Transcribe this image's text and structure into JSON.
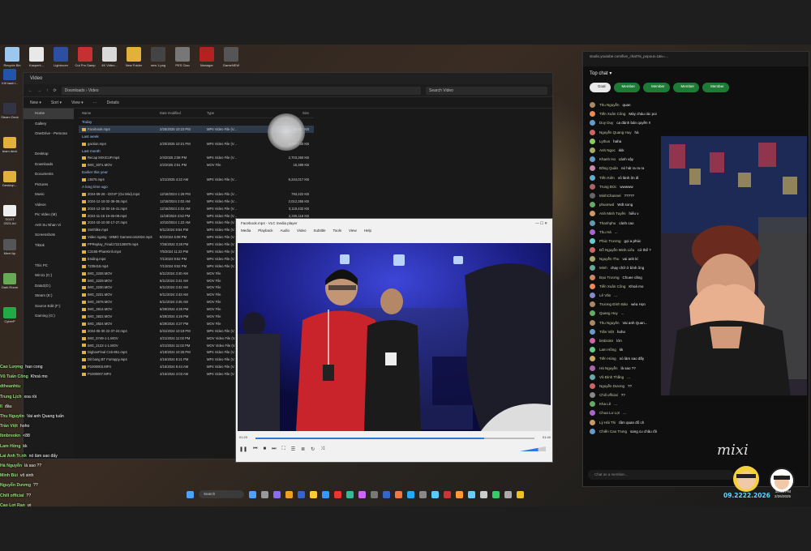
{
  "desktop_icons": [
    {
      "label": "Recycle Bin",
      "color": "#9cc8f0"
    },
    {
      "label": "Kasperk...",
      "color": "#e8e8e8"
    },
    {
      "label": "Lightroom",
      "color": "#2c4fa3"
    },
    {
      "label": "Cut Pro Samp",
      "color": "#c53030"
    },
    {
      "label": "4K Video...",
      "color": "#d9d9d9"
    },
    {
      "label": "New Folder",
      "color": "#e1b13b"
    },
    {
      "label": "new 1.png",
      "color": "#444"
    },
    {
      "label": "PES Ciao",
      "color": "#777"
    },
    {
      "label": "Manager",
      "color": "#b52020"
    },
    {
      "label": "GameNEW",
      "color": "#555"
    }
  ],
  "left_icons": [
    {
      "label": "Kill hash t..",
      "color": "#2255aa"
    },
    {
      "label": "Steam Deck",
      "color": "#334"
    },
    {
      "label": "team deck",
      "color": "#e1b13b"
    },
    {
      "label": "Desktop...",
      "color": "#e1b13b"
    },
    {
      "label": "SGGT 2023-Ad",
      "color": "#eee"
    },
    {
      "label": "Meet Ap",
      "color": "#555"
    },
    {
      "label": "Dark Room",
      "color": "#6a5"
    },
    {
      "label": "CyberP",
      "color": "#2a4"
    }
  ],
  "explorer": {
    "title": "Video",
    "path": "Downloads  ›  Video",
    "search_placeholder": "Search Video",
    "toolbar": [
      "New ▾",
      "Sort ▾",
      "View ▾",
      "···",
      "Details"
    ],
    "nav": [
      "Home",
      "Gallery",
      "OneDrive - Persona",
      "",
      "Desktop",
      "Downloads",
      "Documents",
      "Pictures",
      "Music",
      "Videos",
      "Pic Video (M)",
      "Anh Su Nhan Vi",
      "Screenshots",
      "Tiktok",
      "",
      "This PC",
      "Win11 (C:)",
      "Data2(D:)",
      "Steam (E:)",
      "Source Edit (F:)",
      "Gaming (G:)"
    ],
    "nav_selected": 0,
    "columns": [
      "Name",
      "Date modified",
      "Type",
      "Size"
    ],
    "rows": [
      {
        "group": true,
        "name": "Today"
      },
      {
        "name": "Facebook.mp4",
        "date": "2/26/2025 10:23 PM",
        "type": "MP4 Video File (V...",
        "size": "19,517 KB",
        "hl": true
      },
      {
        "group": true,
        "name": "Last week"
      },
      {
        "name": "gaction.mp4",
        "date": "2/20/2025 10:21 PM",
        "type": "MP4 Video File (V...",
        "size": "4,774,880 KB"
      },
      {
        "group": true,
        "name": "Last month"
      },
      {
        "name": "Recap MIXICUP.mp4",
        "date": "2/4/2025 2:08 PM",
        "type": "MP4 Video File (V...",
        "size": "2,703,360 KB"
      },
      {
        "name": "IMG_3071.MOV",
        "date": "2/2/2025 2:51 PM",
        "type": "MOV File",
        "size": "16,389 KB"
      },
      {
        "group": true,
        "name": "Earlier this year"
      },
      {
        "name": "c3875.mp4",
        "date": "1/21/2025 4:22 AM",
        "type": "MP4 Video File (V...",
        "size": "6,244,017 KB"
      },
      {
        "group": true,
        "name": "A long time ago"
      },
      {
        "name": "2024-08-26 - DGVF (Go Mixi).mp4",
        "date": "12/18/2024 1:26 PM",
        "type": "MP4 Video File (V...",
        "size": "793,222 KB"
      },
      {
        "name": "2024-12-18 02-36-08.mp4",
        "date": "12/18/2024 2:02 AM",
        "type": "MP4 Video File (V...",
        "size": "2,012,355 KB"
      },
      {
        "name": "2024-12-18 02-16-41.mp4",
        "date": "12/18/2024 2:02 AM",
        "type": "MP4 Video File (V...",
        "size": "3,118,432 KB"
      },
      {
        "name": "2024-11-16 16-45-08.mp4",
        "date": "11/18/2024 4:52 PM",
        "type": "MP4 Video File (V...",
        "size": "2,345,116 KB"
      },
      {
        "name": "2024-10-10 00-17-27.mp4",
        "date": "10/10/2024 1:22 AM",
        "type": "MP4 Video File (V...",
        "size": "1,876,221 KB"
      },
      {
        "name": "Smthlike.mp4",
        "date": "9/11/2024 8:54 PM",
        "type": "MP4 Video File (V...",
        "size": "..."
      },
      {
        "name": "Video ngang - MIMO Gamescom2024.mp4",
        "date": "8/2/2024 6:08 PM",
        "type": "MP4 Video File (V...",
        "size": "..."
      },
      {
        "name": "PPReplay_Final1722128879.mp4",
        "date": "7/26/2024 3:28 PM",
        "type": "MP4 Video File (V...",
        "size": "..."
      },
      {
        "name": "C3195-PhanKinh.mp4",
        "date": "7/5/2024 11:23 PM",
        "type": "MP4 Video File (V...",
        "size": "..."
      },
      {
        "name": "Ending.mp4",
        "date": "7/1/2024 9:52 PM",
        "type": "MP4 Video File (V...",
        "size": "..."
      },
      {
        "name": "7235418.mp4",
        "date": "7/1/2024 9:52 PM",
        "type": "MP4 Video File (V...",
        "size": "..."
      },
      {
        "name": "IMG_3228.MOV",
        "date": "6/11/2024 3:40 AM",
        "type": "MOV File",
        "size": "..."
      },
      {
        "name": "IMG_3229.MOV",
        "date": "6/11/2024 3:41 AM",
        "type": "MOV File",
        "size": "..."
      },
      {
        "name": "IMG_3230.MOV",
        "date": "6/11/2024 3:42 AM",
        "type": "MOV File",
        "size": "..."
      },
      {
        "name": "IMG_3231.MOV",
        "date": "6/11/2024 3:43 AM",
        "type": "MOV File",
        "size": "..."
      },
      {
        "name": "IMG_3678.MOV",
        "date": "6/11/2024 3:45 AM",
        "type": "MOV File",
        "size": "..."
      },
      {
        "name": "IMG_3814.MOV",
        "date": "6/29/2024 4:25 PM",
        "type": "MOV File",
        "size": "..."
      },
      {
        "name": "IMG_3822.MOV",
        "date": "6/29/2024 4:26 PM",
        "type": "MOV File",
        "size": "..."
      },
      {
        "name": "IMG_3824.MOV",
        "date": "6/29/2024 4:27 PM",
        "type": "MOV File",
        "size": "..."
      },
      {
        "name": "2024-05-30 22-37-24.mp4",
        "date": "5/31/2024 10:19 PM",
        "type": "MP4 Video File (V...",
        "size": "..."
      },
      {
        "name": "IMG_5749-1-1.MOV",
        "date": "4/21/2024 11:02 PM",
        "type": "MOV Video File (V...",
        "size": "..."
      },
      {
        "name": "IMG_2122-1-1.MOV",
        "date": "4/21/2024 11:02 PM",
        "type": "MOV Video File (V...",
        "size": "..."
      },
      {
        "name": "DigboxFinal C15-851.mp4",
        "date": "4/18/2024 10:26 PM",
        "type": "MP4 Video File (V...",
        "size": "..."
      },
      {
        "name": "Dit bang BT Formppy.mp4",
        "date": "4/15/2024 8:21 PM",
        "type": "MP4 Video File (V...",
        "size": "..."
      },
      {
        "name": "P1000003.MP4",
        "date": "4/15/2024 8:44 AM",
        "type": "MP4 Video File (V...",
        "size": "..."
      },
      {
        "name": "P1000007.MP4",
        "date": "4/15/2024 4:03 AM",
        "type": "MP4 Video File (V...",
        "size": "..."
      }
    ]
  },
  "vlc": {
    "title": "Facebook.mp4 - VLC media player",
    "menu": [
      "Media",
      "Playback",
      "Audio",
      "Video",
      "Subtitle",
      "Tools",
      "View",
      "Help"
    ],
    "time_elapsed": "01:20",
    "time_total": "01:40",
    "progress": 0.82
  },
  "chat": {
    "url": "studio.youtube.com/live_chat?is_popout=1&v=...",
    "title": "Top chat ▾",
    "tabs": [
      "Goal",
      "Member",
      "Member",
      "Member",
      "Member"
    ],
    "input_placeholder": "Chat as a member...",
    "messages": [
      {
        "author": "Thu Nguyễn",
        "text": "quan",
        "color": "#a86"
      },
      {
        "author": "Tiến Xuân Công",
        "text": "Mày cháu rác poi",
        "color": "#e85"
      },
      {
        "author": "Duy Duy",
        "text": "ca đánh bán quyền !!",
        "color": "#69c"
      },
      {
        "author": "Nguyễn Quang Huy",
        "text": "hà",
        "color": "#c66"
      },
      {
        "author": "Lythus",
        "text": "haha",
        "color": "#8c6"
      },
      {
        "author": "Anh Ngoc",
        "text": "kkk",
        "color": "#aa6"
      },
      {
        "author": "Khanh Ho",
        "text": "cành vậy",
        "color": "#69c"
      },
      {
        "author": "Đăng Quân",
        "text": "nó hát ra ra ra",
        "color": "#c8a"
      },
      {
        "author": "Tiến Kiên",
        "text": "vô lành ôn đi",
        "color": "#6ac"
      },
      {
        "author": "Trung Đức",
        "text": "wwwww",
        "color": "#a66"
      },
      {
        "author": "MinhChannel",
        "text": "?????",
        "color": "#666"
      },
      {
        "author": "phuonwd",
        "text": "Wdt song",
        "color": "#6a6"
      },
      {
        "author": "Anh Minh Tuyền",
        "text": "hiểu v",
        "color": "#c96"
      },
      {
        "author": "Thanhphu",
        "text": "cảnh cao",
        "color": "#69a"
      },
      {
        "author": "Thu Hà",
        "text": "...",
        "color": "#a6c"
      },
      {
        "author": "Phúc Trương",
        "text": "gọi a phúc",
        "color": "#6cc"
      },
      {
        "author": "Đỗ Nguyễn Minh Liêu",
        "text": "cứ thể ?",
        "color": "#c66"
      },
      {
        "author": "Nguyễn Thu",
        "text": "vai anh kỉ",
        "color": "#aa6"
      },
      {
        "author": "Minh",
        "text": "chạy chữ ở bình ông",
        "color": "#6a9"
      },
      {
        "author": "Đạo Trương",
        "text": "Chuee căng",
        "color": "#c86"
      },
      {
        "author": "Tiến Xuân Công",
        "text": "Khoá mo",
        "color": "#e85"
      },
      {
        "author": "Lê Văn",
        "text": "...",
        "color": "#88c"
      },
      {
        "author": "Trương Đình Bảo",
        "text": "wéa Họn",
        "color": "#a86"
      },
      {
        "author": "Quang Huy",
        "text": "...",
        "color": "#6a6"
      },
      {
        "author": "Thu Nguyên",
        "text": "Vai anh Quan...",
        "color": "#a86"
      },
      {
        "author": "Trần Việt",
        "text": "hoho",
        "color": "#69c"
      },
      {
        "author": "binbrokn",
        "text": "lớn",
        "color": "#c6a"
      },
      {
        "author": "Lam Hồng",
        "text": "kk",
        "color": "#6c8"
      },
      {
        "author": "Tiến Hùng",
        "text": "nó làm sao đấy",
        "color": "#ca6"
      },
      {
        "author": "Hà Nguyễn",
        "text": "là sao ??",
        "color": "#a6a"
      },
      {
        "author": "Vũ Đình Thắng",
        "text": "...",
        "color": "#6aa"
      },
      {
        "author": "Nguyễn Dương",
        "text": "??",
        "color": "#c66"
      },
      {
        "author": "Chill official",
        "text": "??",
        "color": "#888"
      },
      {
        "author": "Kha Lê",
        "text": "...",
        "color": "#6a6"
      },
      {
        "author": "Chua Lư Lợi",
        "text": "...",
        "color": "#a6c"
      },
      {
        "author": "Lý Hải Thi",
        "text": "tầm quan đổ ch",
        "color": "#c96"
      },
      {
        "author": "Chiến Cao Trung",
        "text": "sang cu châu rồi",
        "color": "#69c"
      }
    ]
  },
  "overlay_chat": [
    {
      "name": "Cao Lượng",
      "text": "hao cong"
    },
    {
      "name": "Vũ Tuấn Công",
      "text": "Khoá mo"
    },
    {
      "name": "dtheanhtu",
      "text": ""
    },
    {
      "name": "Trung Lịch",
      "text": "xoa rồi"
    },
    {
      "name": "ll",
      "text": "đầu"
    },
    {
      "name": "Thu Nguyên",
      "text": "Vai anh Quang tuấn"
    },
    {
      "name": "Trần Việt",
      "text": "hoho"
    },
    {
      "name": "lbnbreokn",
      "text": "<88"
    },
    {
      "name": "Lam Hồng",
      "text": "kk"
    },
    {
      "name": "Lai Anh Tr.nh",
      "text": "nó làm sao đấy"
    },
    {
      "name": "Hà Nguyễn",
      "text": "là sao ??"
    },
    {
      "name": "Minh Bùi",
      "text": "vô sinh"
    },
    {
      "name": "Nguyễn Dương",
      "text": "??"
    },
    {
      "name": "Chill official",
      "text": "??"
    },
    {
      "name": "Cao Lợi Ran",
      "text": "ưi"
    },
    {
      "name": "Lý Hải Thi",
      "text": "tầm quan đổ ch"
    },
    {
      "name": "Chiến Cao Trung",
      "text": "sang cu châu rồi"
    },
    {
      "name": "Hiếu Nguyễn",
      "text": "cho hieure"
    }
  ],
  "taskbar": {
    "search": "Search",
    "icons_colors": [
      "#4aa3ff",
      "#999",
      "#8a6cf0",
      "#f0a020",
      "#36c",
      "#fc3",
      "#39f",
      "#e33",
      "#3b9",
      "#c6f",
      "#777",
      "#36c",
      "#e74",
      "#2af",
      "#888",
      "#5cf",
      "#c33",
      "#f93",
      "#6cf",
      "#ccc",
      "#3c6",
      "#aaa",
      "#f0c020"
    ],
    "time": "10:55 PM",
    "date": "2/26/2025"
  },
  "stream_overlay": {
    "brand": "mixi",
    "date_text": "09.2222.2026"
  }
}
